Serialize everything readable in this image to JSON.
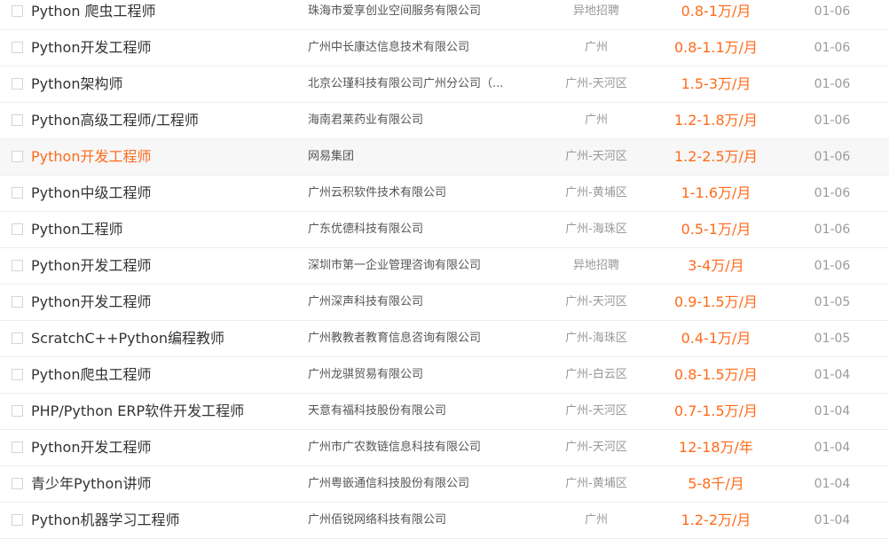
{
  "jobs": [
    {
      "title": "Python 爬虫工程师",
      "company": "珠海市爱享创业空间服务有限公司",
      "location": "异地招聘",
      "salary": "0.8-1万/月",
      "date": "01-06"
    },
    {
      "title": "Python开发工程师",
      "company": "广州中长康达信息技术有限公司",
      "location": "广州",
      "salary": "0.8-1.1万/月",
      "date": "01-06"
    },
    {
      "title": "Python架构师",
      "company": "北京公瑾科技有限公司广州分公司（...",
      "location": "广州-天河区",
      "salary": "1.5-3万/月",
      "date": "01-06"
    },
    {
      "title": "Python高级工程师/工程师",
      "company": "海南君莱药业有限公司",
      "location": "广州",
      "salary": "1.2-1.8万/月",
      "date": "01-06"
    },
    {
      "title": "Python开发工程师",
      "company": "网易集团",
      "location": "广州-天河区",
      "salary": "1.2-2.5万/月",
      "date": "01-06",
      "highlighted": true
    },
    {
      "title": "Python中级工程师",
      "company": "广州云积软件技术有限公司",
      "location": "广州-黄埔区",
      "salary": "1-1.6万/月",
      "date": "01-06"
    },
    {
      "title": "Python工程师",
      "company": "广东优德科技有限公司",
      "location": "广州-海珠区",
      "salary": "0.5-1万/月",
      "date": "01-06"
    },
    {
      "title": "Python开发工程师",
      "company": "深圳市第一企业管理咨询有限公司",
      "location": "异地招聘",
      "salary": "3-4万/月",
      "date": "01-06"
    },
    {
      "title": "Python开发工程师",
      "company": "广州深声科技有限公司",
      "location": "广州-天河区",
      "salary": "0.9-1.5万/月",
      "date": "01-05"
    },
    {
      "title": "ScratchC++Python编程教师",
      "company": "广州教教者教育信息咨询有限公司",
      "location": "广州-海珠区",
      "salary": "0.4-1万/月",
      "date": "01-05"
    },
    {
      "title": "Python爬虫工程师",
      "company": "广州龙骐贸易有限公司",
      "location": "广州-白云区",
      "salary": "0.8-1.5万/月",
      "date": "01-04"
    },
    {
      "title": "PHP/Python ERP软件开发工程师",
      "company": "天意有福科技股份有限公司",
      "location": "广州-天河区",
      "salary": "0.7-1.5万/月",
      "date": "01-04"
    },
    {
      "title": "Python开发工程师",
      "company": "广州市广农数链信息科技有限公司",
      "location": "广州-天河区",
      "salary": "12-18万/年",
      "date": "01-04"
    },
    {
      "title": "青少年Python讲师",
      "company": "广州粤嵌通信科技股份有限公司",
      "location": "广州-黄埔区",
      "salary": "5-8千/月",
      "date": "01-04"
    },
    {
      "title": "Python机器学习工程师",
      "company": "广州佰锐网络科技有限公司",
      "location": "广州",
      "salary": "1.2-2万/月",
      "date": "01-04"
    }
  ]
}
